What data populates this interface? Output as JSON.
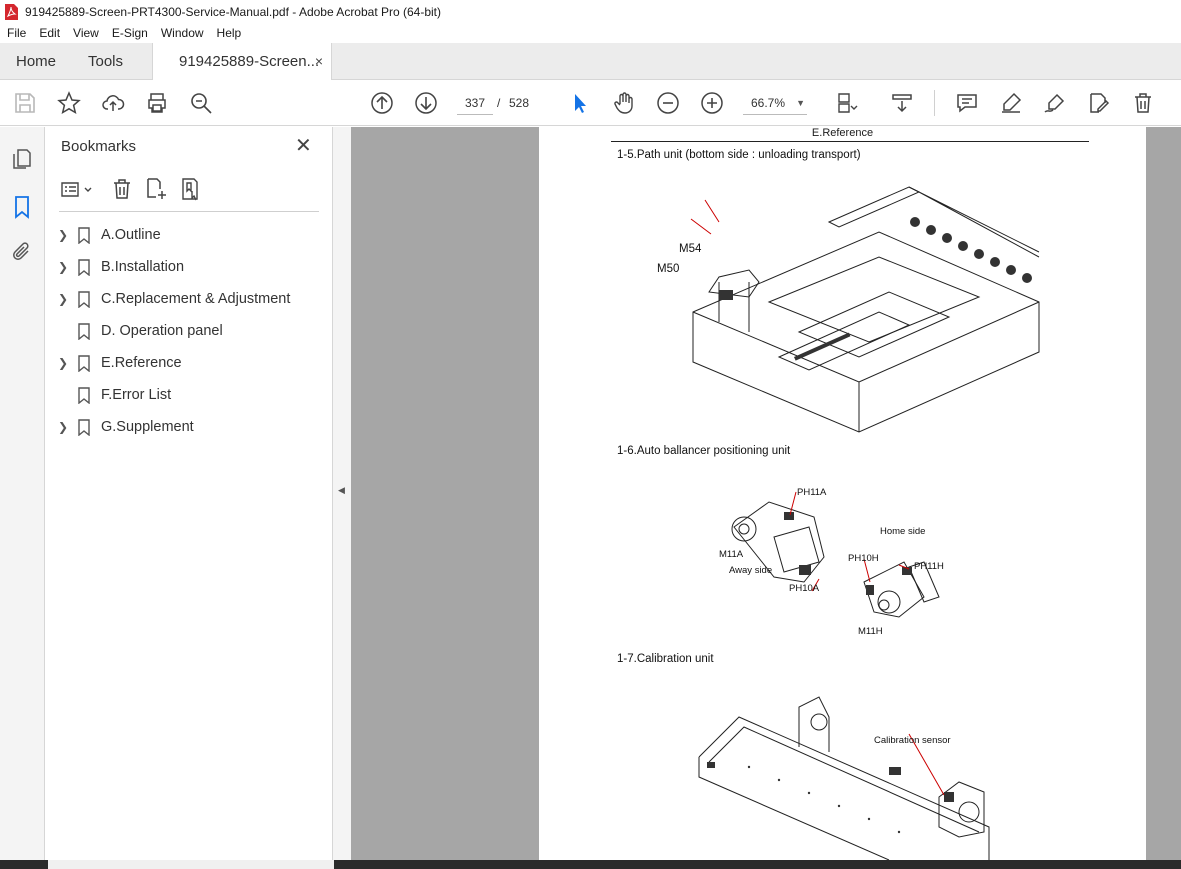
{
  "window": {
    "title": "919425889-Screen-PRT4300-Service-Manual.pdf - Adobe Acrobat Pro (64-bit)"
  },
  "menu": [
    "File",
    "Edit",
    "View",
    "E-Sign",
    "Window",
    "Help"
  ],
  "tabs": {
    "home": "Home",
    "tools": "Tools",
    "document": "919425889-Screen...",
    "close_glyph": "×"
  },
  "toolbar": {
    "page_current": "337",
    "page_separator": "/",
    "page_total": "528",
    "zoom": "66.7%"
  },
  "bookmarks": {
    "title": "Bookmarks",
    "close_glyph": "✕",
    "items": [
      {
        "label": "A.Outline",
        "expandable": true
      },
      {
        "label": "B.Installation",
        "expandable": true
      },
      {
        "label": "C.Replacement & Adjustment",
        "expandable": true
      },
      {
        "label": "D. Operation panel",
        "expandable": false
      },
      {
        "label": "E.Reference",
        "expandable": true
      },
      {
        "label": "F.Error List",
        "expandable": false
      },
      {
        "label": "G.Supplement",
        "expandable": true
      }
    ]
  },
  "document": {
    "header": "E.Reference",
    "sections": [
      {
        "caption": "1-5.Path unit (bottom side : unloading transport)",
        "labels": [
          "M54",
          "M50"
        ]
      },
      {
        "caption": "1-6.Auto ballancer positioning unit",
        "labels": [
          "PH11A",
          "M11A",
          "Away side",
          "PH10A",
          "Home side",
          "PH10H",
          "PH11H",
          "M11H"
        ]
      },
      {
        "caption": "1-7.Calibration unit",
        "labels": [
          "Calibration sensor"
        ]
      }
    ]
  },
  "colors": {
    "accent": "#1473e6",
    "doc_background": "#a6a6a6",
    "pdf_red": "#d4272e"
  }
}
